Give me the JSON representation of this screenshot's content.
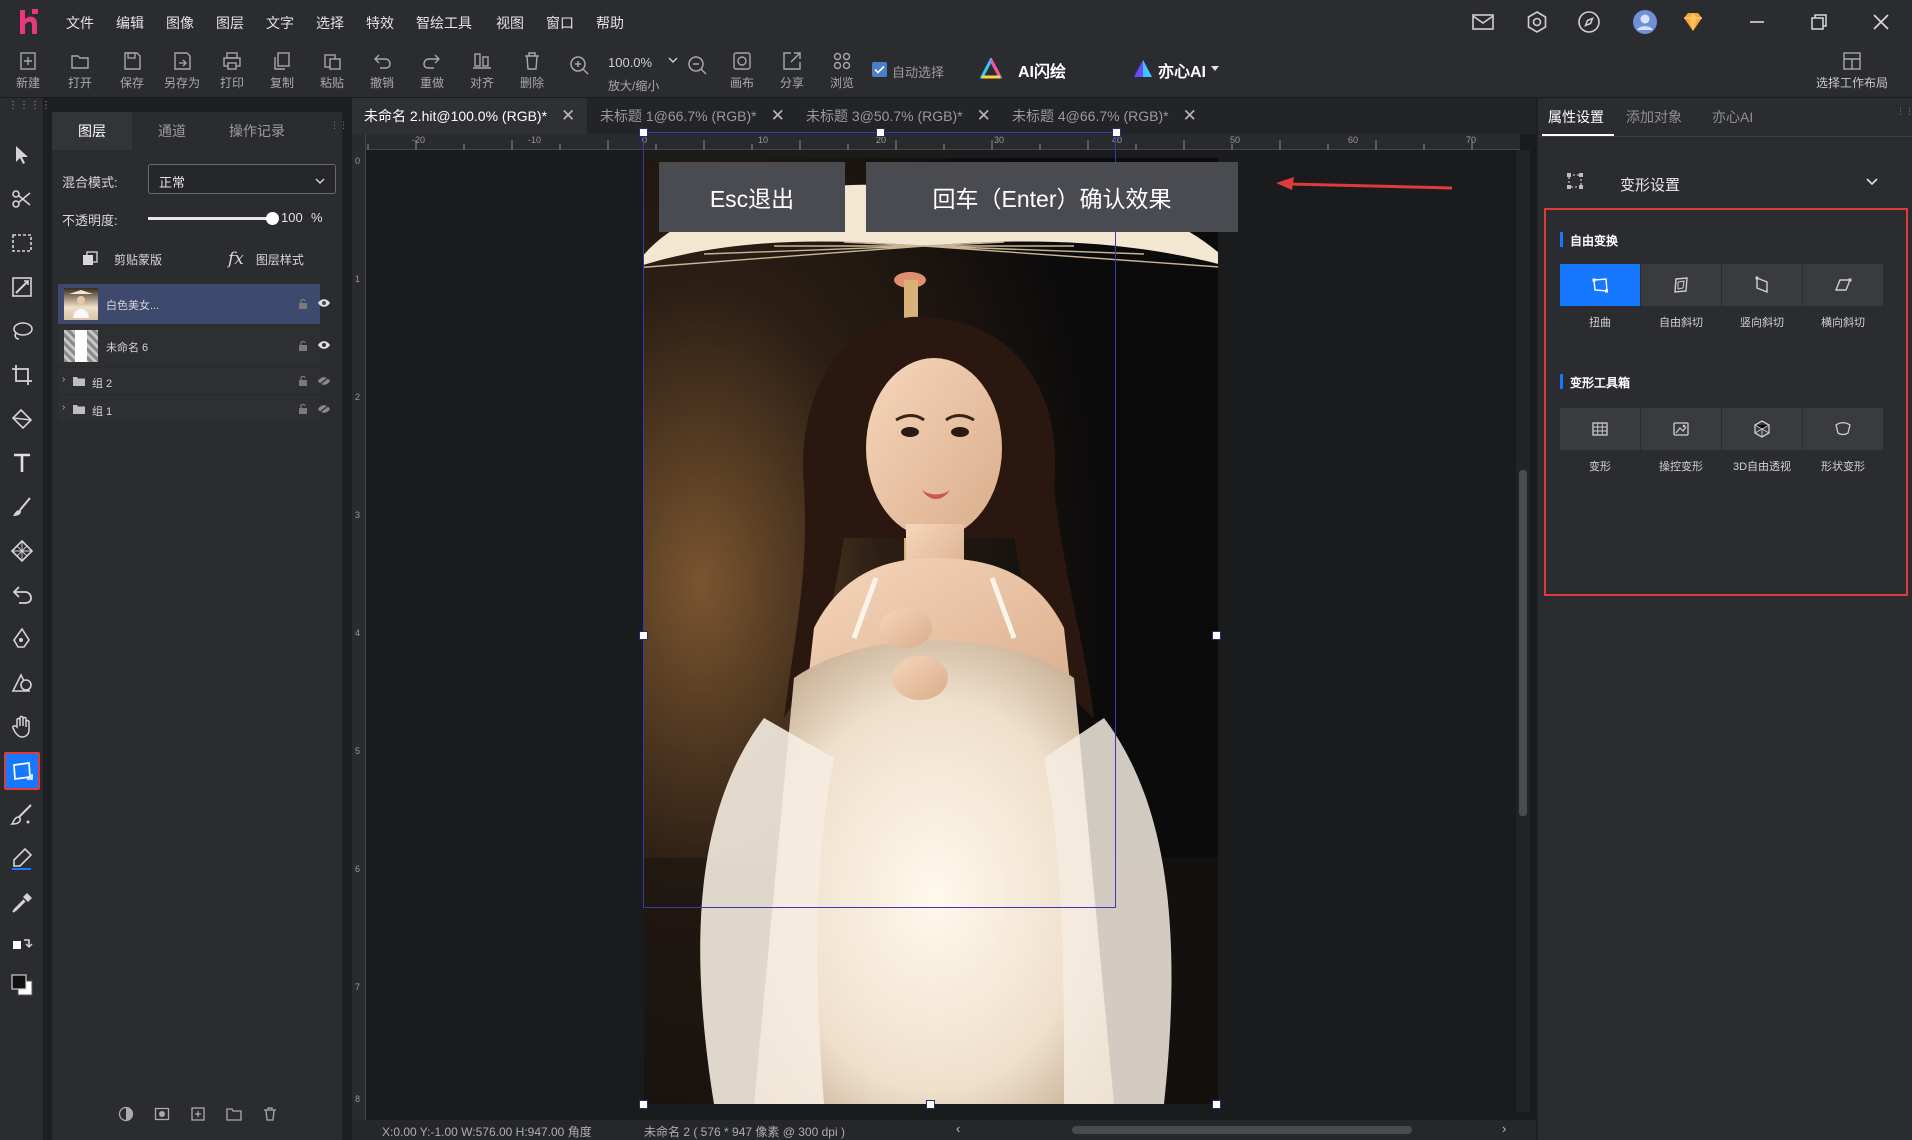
{
  "menubar": {
    "items": [
      "文件",
      "编辑",
      "图像",
      "图层",
      "文字",
      "选择",
      "特效",
      "智绘工具",
      "视图",
      "窗口",
      "帮助"
    ]
  },
  "toolbar": {
    "new_label": "新建",
    "open_label": "打开",
    "save_label": "保存",
    "save_as_label": "另存为",
    "print_label": "打印",
    "copy_label": "复制",
    "paste_label": "粘贴",
    "undo_label": "撤销",
    "redo_label": "重做",
    "align_label": "对齐",
    "delete_label": "删除",
    "zoom_value": "100.0%",
    "zoom_label": "放大/缩小",
    "canvas_label": "画布",
    "share_label": "分享",
    "browse_label": "浏览",
    "auto_select_label": "自动选择",
    "auto_select_checked": true,
    "ai_flash_label": "AI闪绘",
    "yixin_ai_label": "亦心AI",
    "workspace_label": "选择工作布局"
  },
  "layers_panel": {
    "tabs": [
      "图层",
      "通道",
      "操作记录"
    ],
    "blend_mode_label": "混合模式:",
    "blend_mode_value": "正常",
    "opacity_label": "不透明度:",
    "opacity_value": "100",
    "opacity_unit": "%",
    "opacity_fraction": 1.0,
    "clip_mask_label": "剪贴蒙版",
    "layer_style_label": "图层样式",
    "layers": [
      {
        "name": "白色美女...",
        "selected": true
      },
      {
        "name": "未命名 6",
        "selected": false
      },
      {
        "name": "组 2",
        "selected": false
      },
      {
        "name": "组 1",
        "selected": false
      }
    ]
  },
  "document_tabs": [
    {
      "label": "未命名 2.hit@100.0% (RGB)*",
      "active": true
    },
    {
      "label": "未标题 1@66.7% (RGB)*",
      "active": false
    },
    {
      "label": "未标题 3@50.7% (RGB)*",
      "active": false
    },
    {
      "label": "未标题 4@66.7% (RGB)*",
      "active": false
    }
  ],
  "ruler": {
    "top_labels": [
      "-20",
      "-10",
      "0",
      "10",
      "20",
      "30",
      "40",
      "50",
      "60",
      "70"
    ],
    "left_labels": [
      "0",
      "1",
      "2",
      "3",
      "4",
      "5",
      "6",
      "7",
      "8"
    ]
  },
  "overlay": {
    "esc_label": "Esc退出",
    "enter_label": "回车（Enter）确认效果"
  },
  "statusbar": {
    "coords": "X:0.00 Y:-1.00 W:576.00 H:947.00 角度",
    "doc_info": "未命名 2 ( 576 * 947 像素 @ 300 dpi )"
  },
  "right_panel": {
    "tabs": [
      "属性设置",
      "添加对象",
      "亦心AI"
    ],
    "section_title": "变形设置",
    "free_transform_title": "自由变换",
    "free_transform_items": [
      "扭曲",
      "自由斜切",
      "竖向斜切",
      "横向斜切"
    ],
    "toolbox_title": "变形工具箱",
    "toolbox_items": [
      "变形",
      "操控变形",
      "3D自由透视",
      "形状变形"
    ]
  },
  "colors": {
    "accent": "#1677ff",
    "highlight_red": "#e03a3a",
    "panel_bg": "#2b2c2f",
    "canvas_bg": "#1a1b1d"
  }
}
